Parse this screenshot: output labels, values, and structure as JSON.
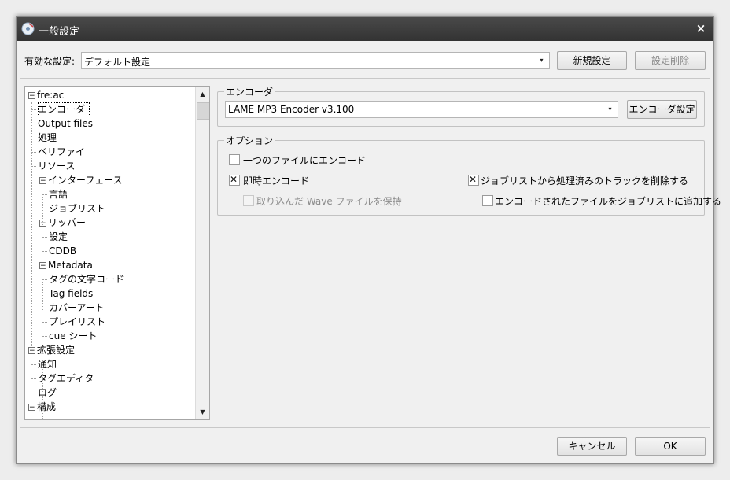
{
  "window": {
    "title": "一般設定",
    "close_glyph": "×"
  },
  "profile": {
    "label": "有効な設定:",
    "selected": "デフォルト設定",
    "new_button": "新規設定",
    "delete_button": "設定削除"
  },
  "tree": {
    "items": [
      {
        "label": "fre:ac"
      },
      {
        "label": "エンコーダ"
      },
      {
        "label": "Output files"
      },
      {
        "label": "処理"
      },
      {
        "label": "ベリファイ"
      },
      {
        "label": "リソース"
      },
      {
        "label": "インターフェース"
      },
      {
        "label": "言語"
      },
      {
        "label": "ジョブリスト"
      },
      {
        "label": "リッパー"
      },
      {
        "label": "設定"
      },
      {
        "label": "CDDB"
      },
      {
        "label": "Metadata"
      },
      {
        "label": "タグの文字コード"
      },
      {
        "label": "Tag fields"
      },
      {
        "label": "カバーアート"
      },
      {
        "label": "プレイリスト"
      },
      {
        "label": "cue シート"
      },
      {
        "label": "拡張設定"
      },
      {
        "label": "通知"
      },
      {
        "label": "タグエディタ"
      },
      {
        "label": "ログ"
      },
      {
        "label": "構成"
      }
    ],
    "expander_glyph": "−"
  },
  "encoder_group": {
    "title": "エンコーダ",
    "selected": "LAME MP3 Encoder v3.100",
    "config_button": "エンコーダ設定"
  },
  "options_group": {
    "title": "オプション",
    "single_file": {
      "label": "一つのファイルにエンコード",
      "checked": false
    },
    "on_the_fly": {
      "label": "即時エンコード",
      "checked": true
    },
    "keep_wave": {
      "label": "取り込んだ Wave ファイルを保持",
      "checked": false,
      "disabled": true
    },
    "remove_tracks": {
      "label": "ジョブリストから処理済みのトラックを削除する",
      "checked": true
    },
    "add_encoded": {
      "label": "エンコードされたファイルをジョブリストに追加する",
      "checked": false
    }
  },
  "footer": {
    "cancel_button": "キャンセル",
    "ok_button": "OK"
  },
  "icons": {
    "combo_arrow": "▾",
    "scroll_up": "▲",
    "scroll_down": "▼"
  }
}
